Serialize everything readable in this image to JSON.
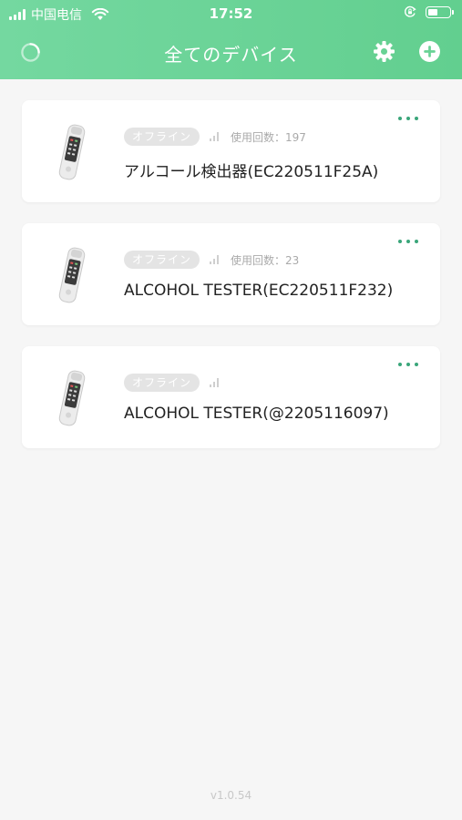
{
  "status_bar": {
    "carrier": "中国电信",
    "time": "17:52"
  },
  "header": {
    "title": "全てのデバイス"
  },
  "devices": [
    {
      "status": "オフライン",
      "usage_label": "使用回数：197",
      "name": "アルコール検出器(EC220511F25A)"
    },
    {
      "status": "オフライン",
      "usage_label": "使用回数：23",
      "name": "ALCOHOL TESTER(EC220511F232)"
    },
    {
      "status": "オフライン",
      "usage_label": "",
      "name": "ALCOHOL TESTER(@2205116097)"
    }
  ],
  "footer": {
    "version": "v1.0.54"
  },
  "colors": {
    "header_gradient_start": "#74d8a0",
    "header_gradient_end": "#62cf8f",
    "accent_dots": "#3aa67a",
    "badge_bg": "#e4e4e4",
    "background": "#f6f6f6"
  },
  "icons": {
    "loading": "loading-circle-icon",
    "settings": "gear-icon",
    "add": "plus-circle-icon",
    "more": "more-dots-icon",
    "signal": "signal-bars-icon",
    "device": "alcohol-tester-device-icon"
  }
}
